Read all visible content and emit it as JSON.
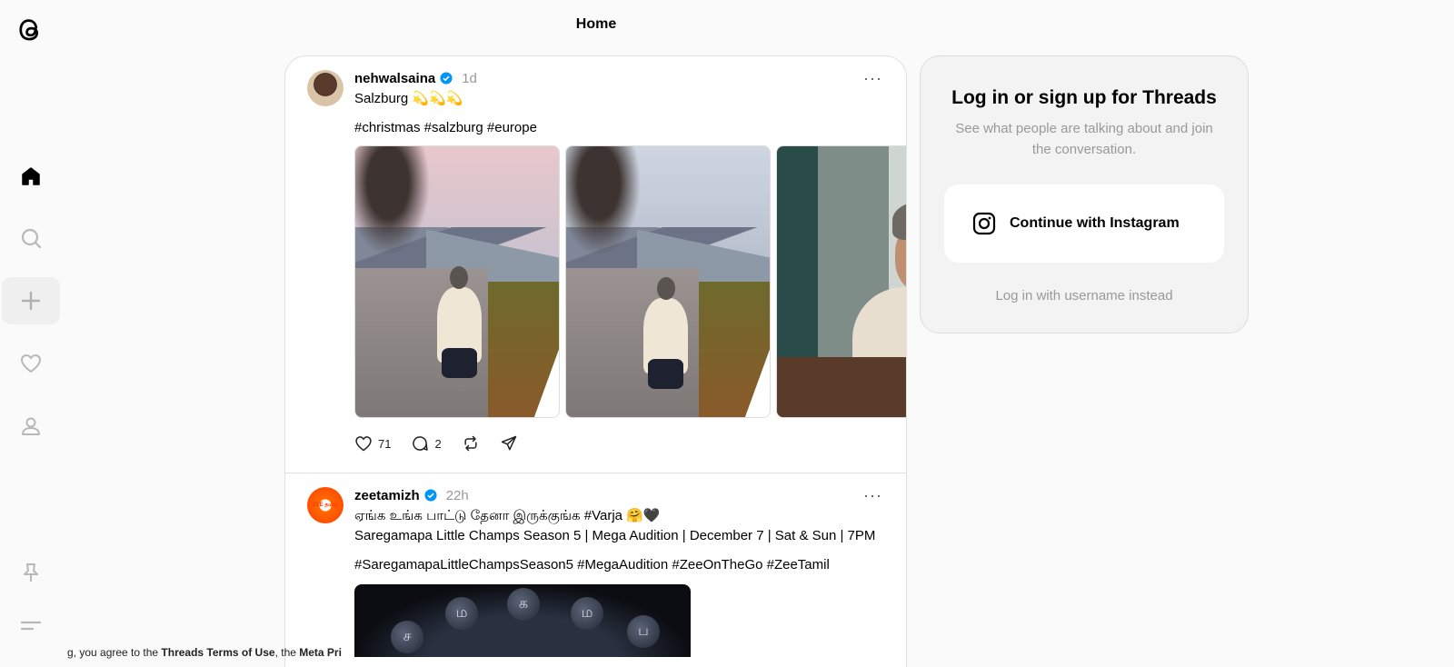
{
  "header": {
    "title": "Home"
  },
  "sidebar": {
    "items": [
      {
        "name": "home",
        "icon": "home-icon"
      },
      {
        "name": "search",
        "icon": "search-icon"
      },
      {
        "name": "create",
        "icon": "plus-icon"
      },
      {
        "name": "activity",
        "icon": "heart-icon"
      },
      {
        "name": "profile",
        "icon": "user-icon"
      },
      {
        "name": "pinned",
        "icon": "pin-icon"
      },
      {
        "name": "menu",
        "icon": "menu-icon"
      }
    ]
  },
  "posts": [
    {
      "username": "nehwalsaina",
      "time": "1d",
      "text": "Salzburg 💫💫💫",
      "tags": "#christmas #salzburg #europe",
      "likes": "71",
      "replies": "2"
    },
    {
      "username": "zeetamizh",
      "time": "22h",
      "text_line1": "ஏங்க உங்க பாட்டு தேனா இருக்குங்க #Varja 🤗🖤",
      "text_line2": "Saregamapa Little Champs Season 5 | Mega Audition | December 7 | Sat & Sun | 7PM",
      "tags": "#SaregamapaLittleChampsSeason5 #MegaAudition #ZeeOnTheGo #ZeeTamil",
      "avatar_text": "ZEE தமிழ்",
      "video_glyphs": [
        "ச",
        "ம",
        "க",
        "ம",
        "ப"
      ]
    }
  ],
  "login": {
    "title": "Log in or sign up for Threads",
    "subtitle": "See what people are talking about and join the conversation.",
    "instagram_button": "Continue with Instagram",
    "alt_login": "Log in with username instead"
  },
  "footer": {
    "prefix": "g, you agree to the ",
    "terms": "Threads Terms of Use",
    "middle": ", the ",
    "privacy": "Meta Pri"
  },
  "colors": {
    "verified": "#0095f6",
    "muted": "#999999",
    "border": "#e0e0e0"
  }
}
